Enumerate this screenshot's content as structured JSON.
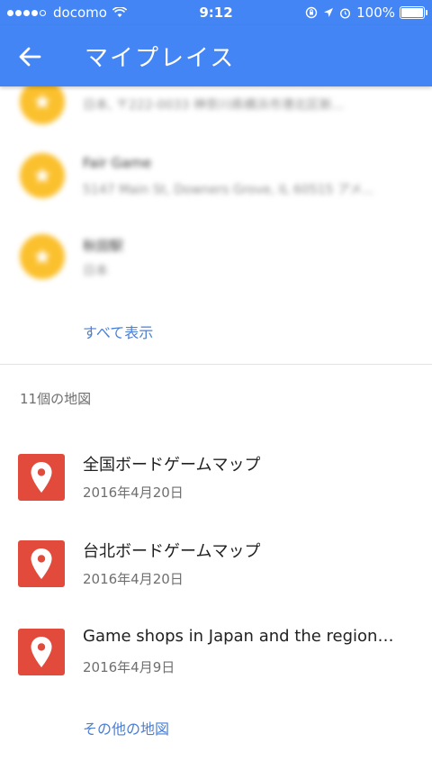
{
  "status_bar": {
    "carrier": "docomo",
    "time": "9:12",
    "battery": "100%"
  },
  "header": {
    "title": "マイプレイス",
    "back_icon": "arrow-left-icon"
  },
  "colors": {
    "primary": "#4385f4",
    "star": "#fbc02d",
    "map_icon": "#e24b3c",
    "link": "#4a7fd6"
  },
  "places": [
    {
      "name": "",
      "address": "日本, 〒222-0033 神奈川県横浜市港北区新..."
    },
    {
      "name": "Fair Game",
      "address": "5147 Main St, Downers Grove, IL 60515 アメ..."
    },
    {
      "name": "秋田駅",
      "address": "日本"
    }
  ],
  "places_show_all": "すべて表示",
  "maps": {
    "section_title": "11個の地図",
    "items": [
      {
        "name": "全国ボードゲームマップ",
        "date": "2016年4月20日"
      },
      {
        "name": "台北ボードゲームマップ",
        "date": "2016年4月20日"
      },
      {
        "name": "Game shops in Japan and the region…",
        "date": "2016年4月9日"
      }
    ],
    "more_link": "その他の地図"
  }
}
